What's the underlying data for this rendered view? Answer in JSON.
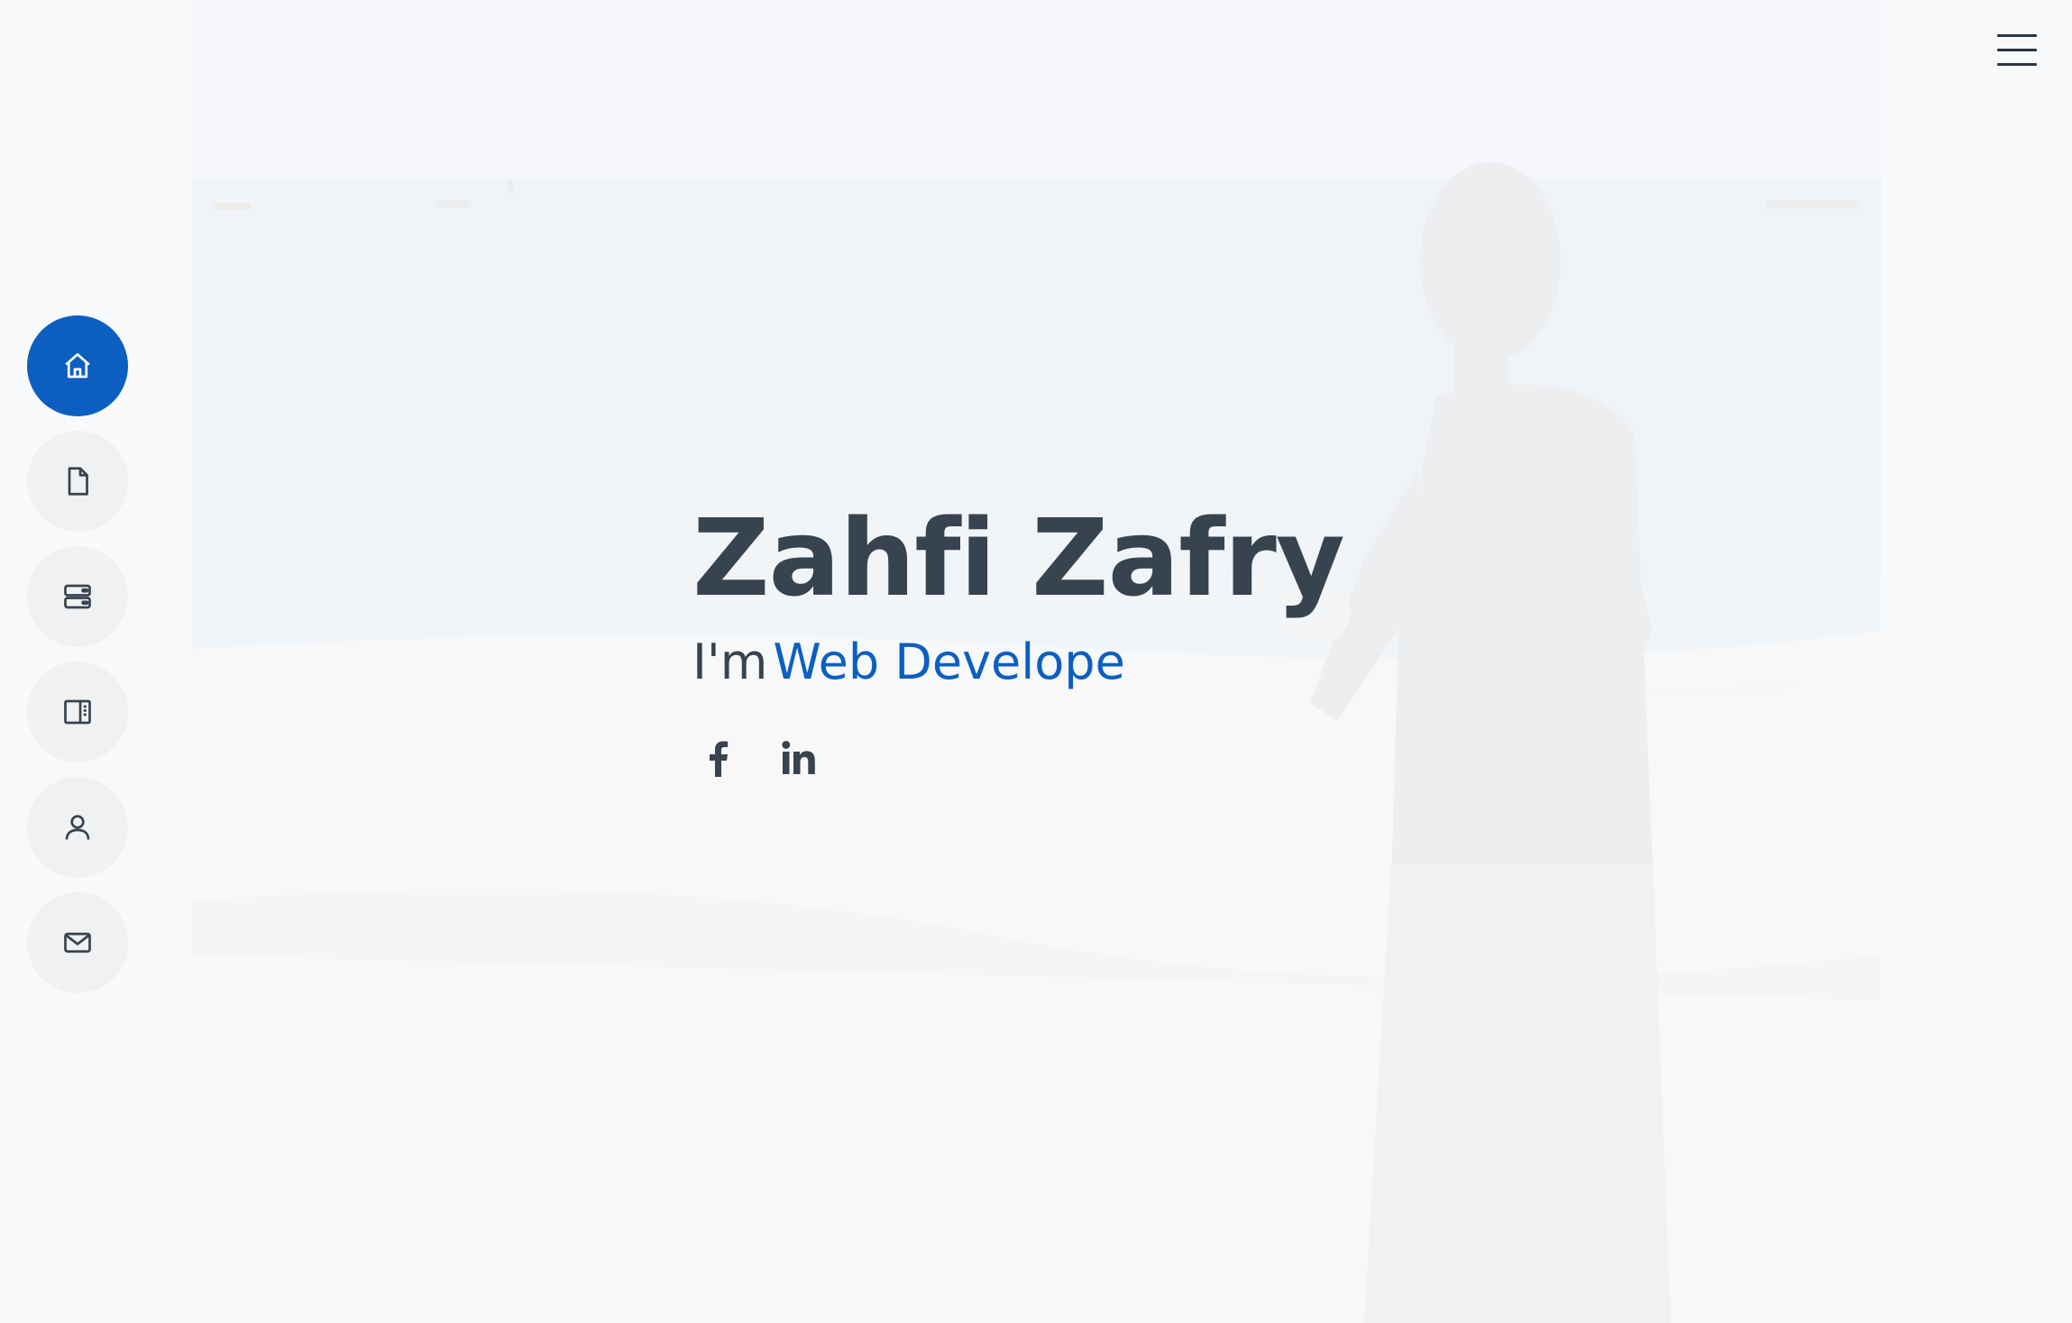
{
  "hero": {
    "name": "Zahfi Zafry",
    "intro": "I'm",
    "typed_role": "Web Develope",
    "accent_color": "#0c5fc1",
    "text_color": "#37434f"
  },
  "social": [
    {
      "icon": "facebook-icon"
    },
    {
      "icon": "linkedin-icon"
    }
  ],
  "nav": {
    "items": [
      {
        "icon": "home-icon",
        "active": true
      },
      {
        "icon": "document-icon",
        "active": false
      },
      {
        "icon": "server-icon",
        "active": false
      },
      {
        "icon": "layout-sidebar-icon",
        "active": false
      },
      {
        "icon": "person-icon",
        "active": false
      },
      {
        "icon": "envelope-icon",
        "active": false
      }
    ]
  },
  "menu": {
    "icon": "hamburger-menu-icon"
  }
}
